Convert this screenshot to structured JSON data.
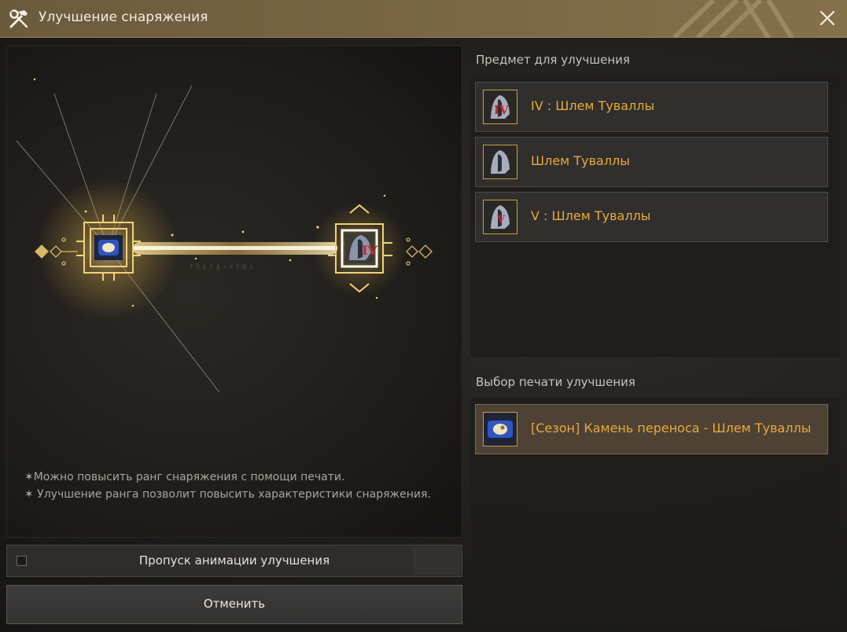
{
  "window": {
    "title": "Улучшение снаряжения",
    "title_icon": "hammer-wrench-icon",
    "close_icon": "close-icon"
  },
  "animation": {
    "source_item_icon": "transfer-stone-icon",
    "target_item_icon": "helmet-icon",
    "target_rank_badge": "IV",
    "notes": [
      "✶Можно повысить ранг снаряжения с помощи печати.",
      "✶ Улучшение ранга позволит повысить характеристики снаряжения."
    ]
  },
  "skip_animation": {
    "label": "Пропуск анимации улучшения",
    "checked": false
  },
  "cancel_button": {
    "label": "Отменить"
  },
  "items_section": {
    "title": "Предмет для улучшения",
    "items": [
      {
        "label": "IV : Шлем Туваллы",
        "icon": "helmet-icon",
        "badge": "IV"
      },
      {
        "label": "Шлем Туваллы",
        "icon": "helmet-icon",
        "badge": ""
      },
      {
        "label": "V : Шлем Туваллы",
        "icon": "helmet-icon",
        "badge": "V"
      }
    ]
  },
  "seal_section": {
    "title": "Выбор печати улучшения",
    "items": [
      {
        "label": "[Сезон] Камень переноса - Шлем Туваллы",
        "icon": "transfer-stone-icon",
        "selected": true
      }
    ]
  },
  "colors": {
    "accent_gold": "#e9a93a",
    "titlebar": "#7c6845",
    "icon_border": "#c9a03c",
    "selected_row": "#4e4235"
  }
}
